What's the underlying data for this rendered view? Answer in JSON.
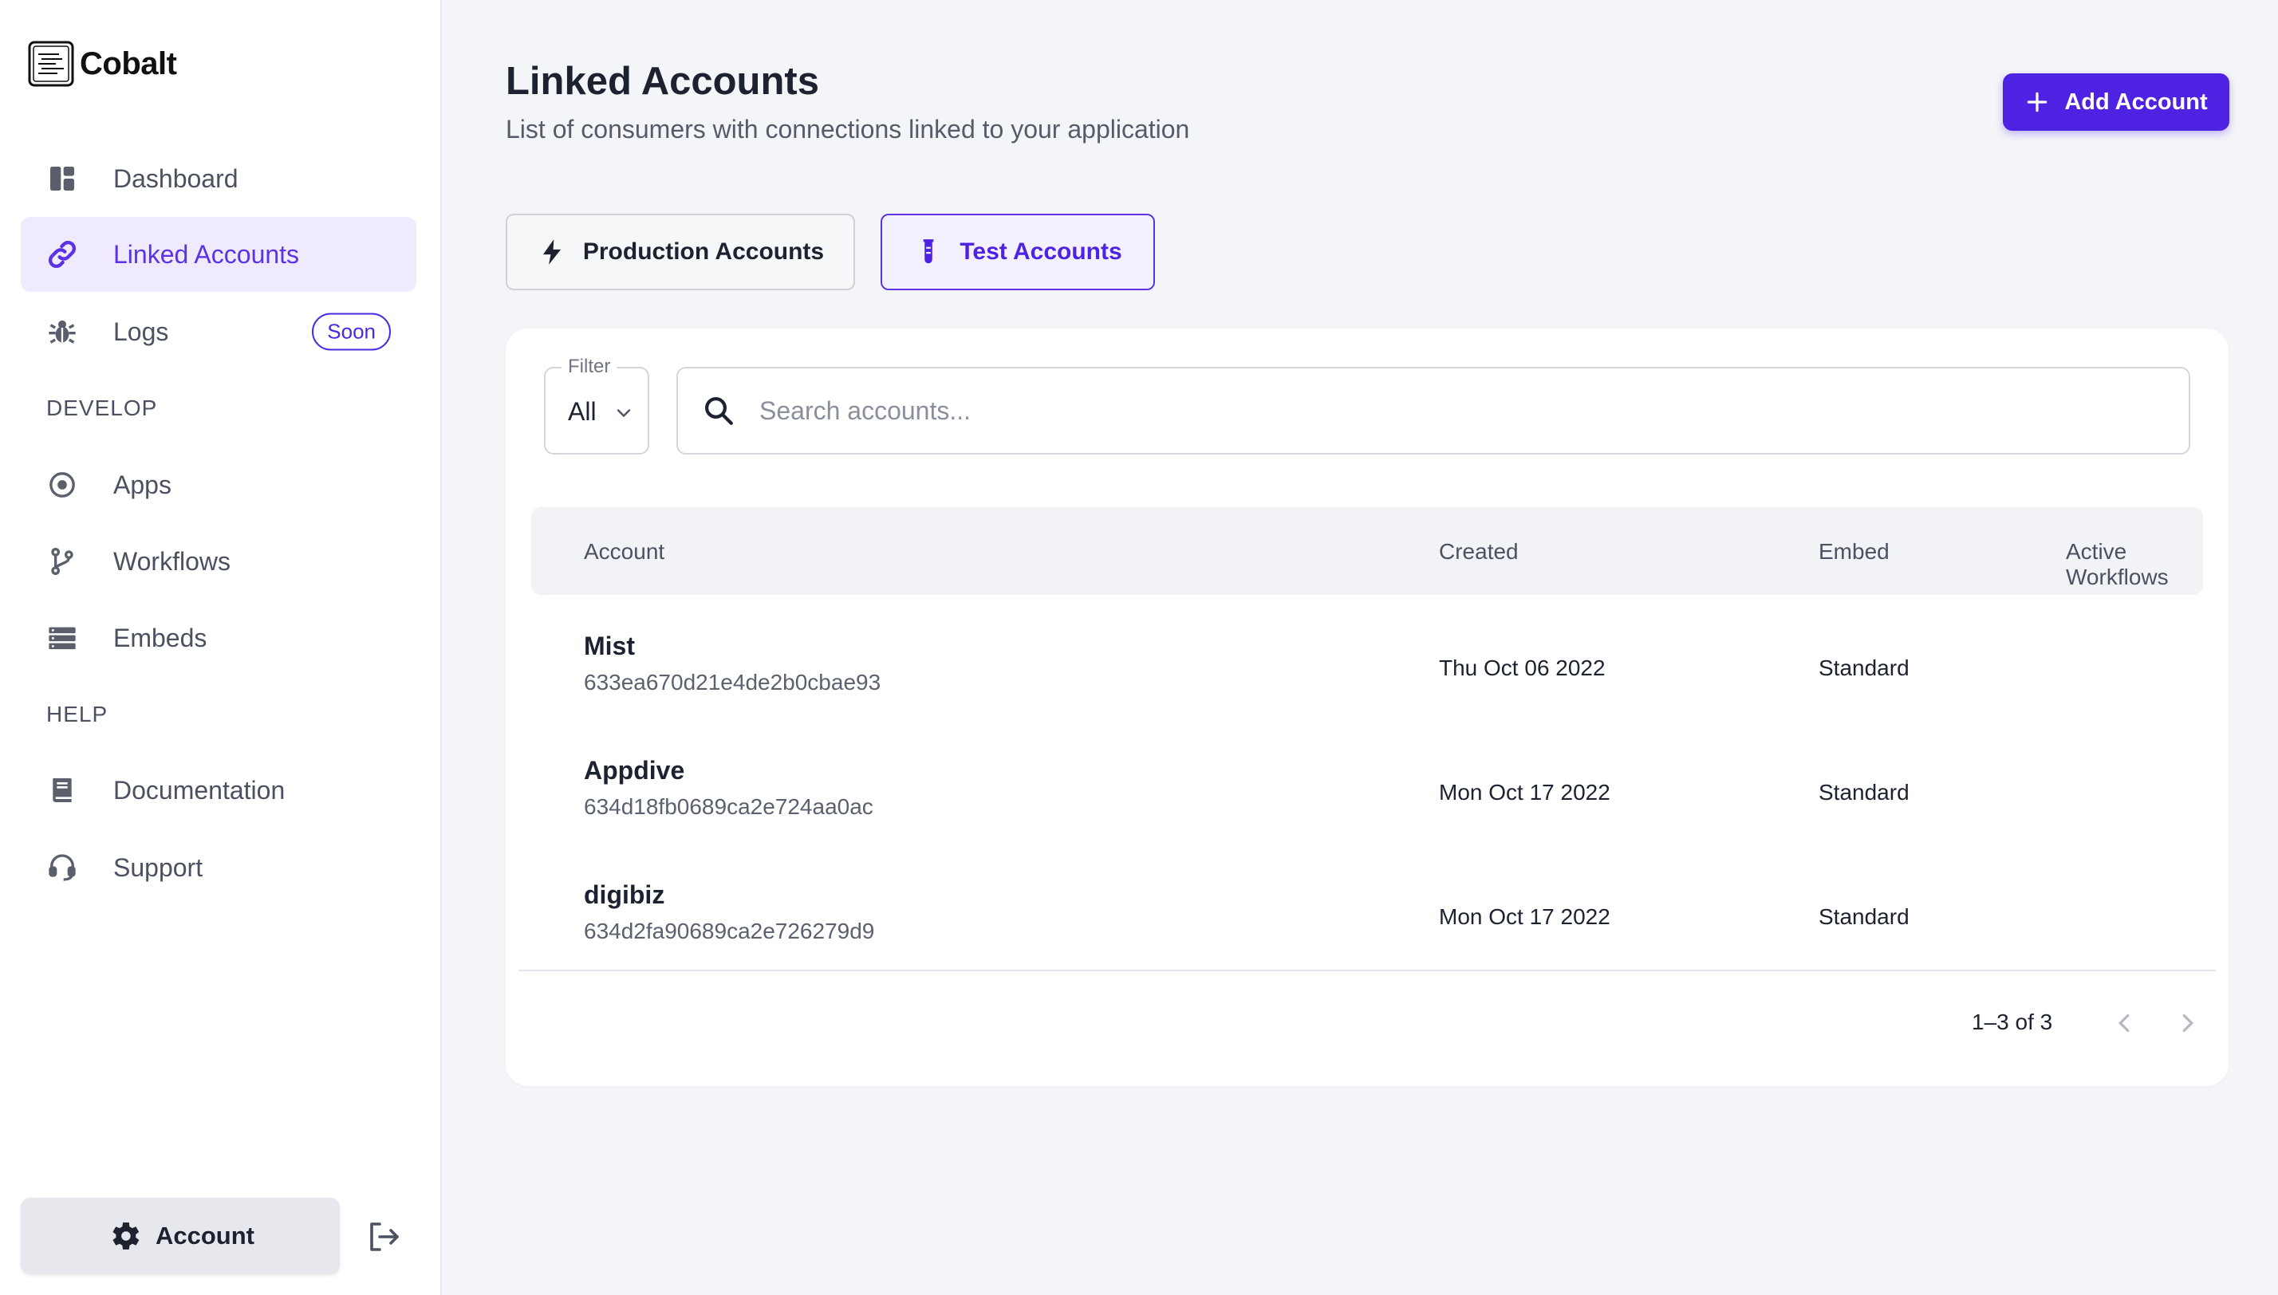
{
  "brand": {
    "name": "Cobalt"
  },
  "sidebar": {
    "items": [
      {
        "label": "Dashboard",
        "icon": "dashboard-icon"
      },
      {
        "label": "Linked Accounts",
        "icon": "link-icon",
        "active": true
      },
      {
        "label": "Logs",
        "icon": "bug-icon",
        "badge": "Soon"
      }
    ],
    "develop_label": "DEVELOP",
    "develop_items": [
      {
        "label": "Apps",
        "icon": "apps-icon"
      },
      {
        "label": "Workflows",
        "icon": "workflow-branch-icon"
      },
      {
        "label": "Embeds",
        "icon": "embeds-icon"
      }
    ],
    "help_label": "HELP",
    "help_items": [
      {
        "label": "Documentation",
        "icon": "book-icon"
      },
      {
        "label": "Support",
        "icon": "headset-icon"
      }
    ],
    "account_label": "Account"
  },
  "header": {
    "title": "Linked Accounts",
    "subtitle": "List of consumers with connections linked to your application",
    "add_button": "Add Account"
  },
  "tabs": [
    {
      "label": "Production Accounts",
      "icon": "bolt-icon",
      "selected": false
    },
    {
      "label": "Test Accounts",
      "icon": "test-tube-icon",
      "selected": true
    }
  ],
  "filter": {
    "label": "Filter",
    "value": "All"
  },
  "search": {
    "placeholder": "Search accounts..."
  },
  "table": {
    "columns": [
      "Account",
      "Created",
      "Embed",
      "Active Workflows"
    ],
    "rows": [
      {
        "name": "Mist",
        "id": "633ea670d21e4de2b0cbae93",
        "created": "Thu Oct 06 2022",
        "embed": "Standard"
      },
      {
        "name": "Appdive",
        "id": "634d18fb0689ca2e724aa0ac",
        "created": "Mon Oct 17 2022",
        "embed": "Standard"
      },
      {
        "name": "digibiz",
        "id": "634d2fa90689ca2e726279d9",
        "created": "Mon Oct 17 2022",
        "embed": "Standard"
      }
    ]
  },
  "pagination": {
    "text": "1–3 of 3"
  },
  "colors": {
    "accent": "#4d22e3",
    "active_nav_bg": "#efeafd",
    "page_bg": "#f4f5f8"
  }
}
